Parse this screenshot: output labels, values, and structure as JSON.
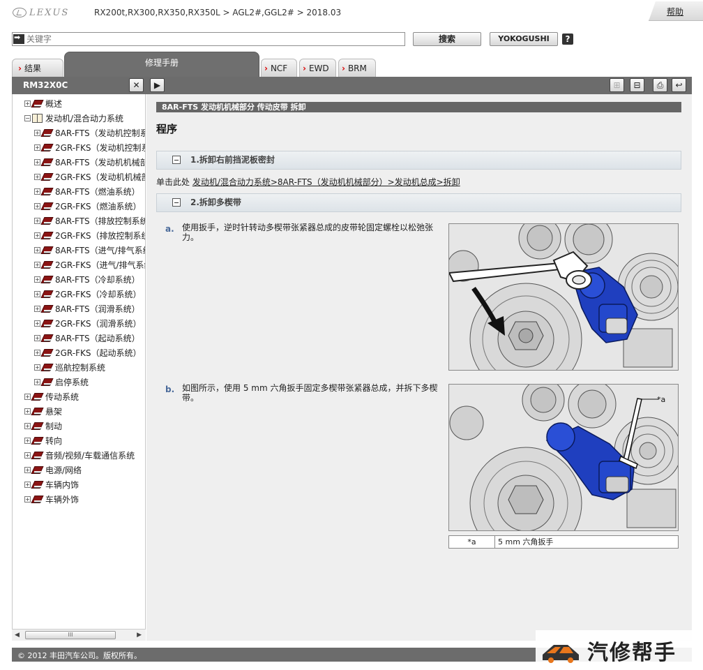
{
  "header": {
    "brand": "LEXUS",
    "breadcrumb": "RX200t,RX300,RX350,RX350L > AGL2#,GGL2# > 2018.03",
    "help_label": "帮助"
  },
  "search": {
    "placeholder": "关键字",
    "value": "",
    "search_button": "搜索",
    "yokogushi_button": "YOKOGUSHI",
    "help_icon": "?"
  },
  "tabs": [
    {
      "label": "结果",
      "active": false
    },
    {
      "label": "修理手册",
      "active": true
    },
    {
      "label": "NCF",
      "active": false
    },
    {
      "label": "EWD",
      "active": false
    },
    {
      "label": "BRM",
      "active": false
    }
  ],
  "toolbar": {
    "doc_code": "RM32X0C",
    "close_icon": "close-icon",
    "expand_icon": "play-right-icon",
    "zoom_in_icon": "expand-all-icon",
    "zoom_out_icon": "collapse-all-icon",
    "print_icon": "print-icon",
    "back_icon": "return-icon"
  },
  "tree": {
    "items": [
      {
        "label": "概述",
        "level": 0,
        "open": false
      },
      {
        "label": "发动机/混合动力系统",
        "level": 0,
        "open": true
      },
      {
        "label": "8AR-FTS（发动机控制系",
        "level": 1,
        "open": false
      },
      {
        "label": "2GR-FKS（发动机控制系",
        "level": 1,
        "open": false
      },
      {
        "label": "8AR-FTS（发动机机械部",
        "level": 1,
        "open": false
      },
      {
        "label": "2GR-FKS（发动机机械部",
        "level": 1,
        "open": false
      },
      {
        "label": "8AR-FTS（燃油系统）",
        "level": 1,
        "open": false
      },
      {
        "label": "2GR-FKS（燃油系统）",
        "level": 1,
        "open": false
      },
      {
        "label": "8AR-FTS（排放控制系统",
        "level": 1,
        "open": false
      },
      {
        "label": "2GR-FKS（排放控制系统",
        "level": 1,
        "open": false
      },
      {
        "label": "8AR-FTS（进气/排气系统",
        "level": 1,
        "open": false
      },
      {
        "label": "2GR-FKS（进气/排气系统",
        "level": 1,
        "open": false
      },
      {
        "label": "8AR-FTS（冷却系统）",
        "level": 1,
        "open": false
      },
      {
        "label": "2GR-FKS（冷却系统）",
        "level": 1,
        "open": false
      },
      {
        "label": "8AR-FTS（润滑系统）",
        "level": 1,
        "open": false
      },
      {
        "label": "2GR-FKS（润滑系统）",
        "level": 1,
        "open": false
      },
      {
        "label": "8AR-FTS（起动系统）",
        "level": 1,
        "open": false
      },
      {
        "label": "2GR-FKS（起动系统）",
        "level": 1,
        "open": false
      },
      {
        "label": "巡航控制系统",
        "level": 1,
        "open": false
      },
      {
        "label": "启停系统",
        "level": 1,
        "open": false
      },
      {
        "label": "传动系统",
        "level": 0,
        "open": false
      },
      {
        "label": "悬架",
        "level": 0,
        "open": false
      },
      {
        "label": "制动",
        "level": 0,
        "open": false
      },
      {
        "label": "转向",
        "level": 0,
        "open": false
      },
      {
        "label": "音频/视频/车载通信系统",
        "level": 0,
        "open": false
      },
      {
        "label": "电源/网络",
        "level": 0,
        "open": false
      },
      {
        "label": "车辆内饰",
        "level": 0,
        "open": false
      },
      {
        "label": "车辆外饰",
        "level": 0,
        "open": false
      }
    ],
    "scroll_thumb_label": "III"
  },
  "content": {
    "procedure_header": "8AR-FTS 发动机机械部分  传动皮带  拆卸",
    "procedure_title": "程序",
    "step1": {
      "title": "1.拆卸右前挡泥板密封"
    },
    "ref_prefix": "单击此处 ",
    "ref_link": "发动机/混合动力系统>8AR-FTS（发动机机械部分）>发动机总成>拆卸",
    "step2": {
      "title": "2.拆卸多楔带"
    },
    "substep_a": {
      "letter": "a.",
      "text": "使用扳手，逆时针转动多楔带张紧器总成的皮带轮固定螺栓以松弛张力。"
    },
    "substep_b": {
      "letter": "b.",
      "text": "如图所示，使用 5 mm 六角扳手固定多楔带张紧器总成，并拆下多楔带。",
      "callout_label": "*a"
    },
    "callouts": [
      {
        "key": "*a",
        "value": "5 mm 六角扳手"
      }
    ]
  },
  "footer": {
    "copyright": "© 2012 丰田汽车公司。版权所有。"
  },
  "watermark": {
    "text": "汽修帮手"
  },
  "colors": {
    "toolbar_bg": "#6c6c6c",
    "tab_active_bg": "#6f6f6f",
    "content_bg": "#efefef",
    "tensioner_blue": "#1f3fbf",
    "chevron_red": "#dd0000"
  }
}
